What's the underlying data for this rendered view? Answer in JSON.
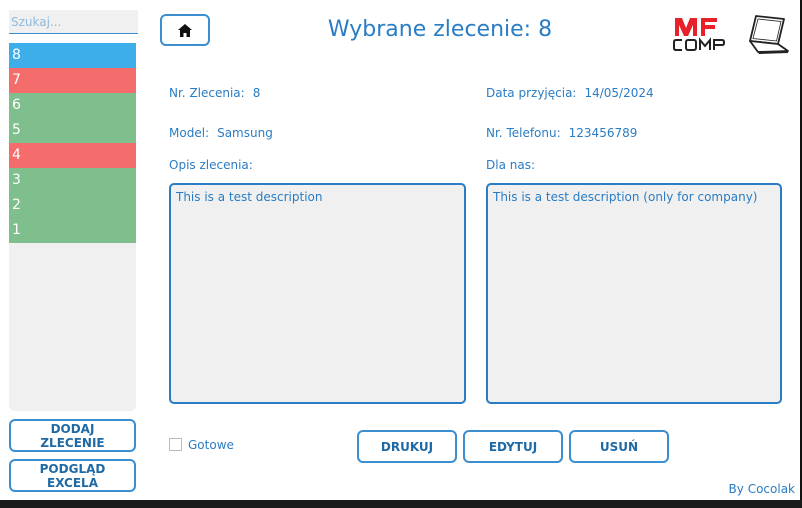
{
  "sidebar": {
    "search_placeholder": "Szukaj...",
    "orders": [
      {
        "label": "8",
        "color": "#3daee9"
      },
      {
        "label": "7",
        "color": "#f56c6c"
      },
      {
        "label": "6",
        "color": "#7fbf8e"
      },
      {
        "label": "5",
        "color": "#7fbf8e"
      },
      {
        "label": "4",
        "color": "#f56c6c"
      },
      {
        "label": "3",
        "color": "#7fbf8e"
      },
      {
        "label": "2",
        "color": "#7fbf8e"
      },
      {
        "label": "1",
        "color": "#7fbf8e"
      }
    ],
    "add_order_label": "DODAJ ZLECENIE",
    "excel_preview_label": "PODGLĄD EXCELA"
  },
  "header": {
    "home_icon": "home-icon",
    "title": "Wybrane zlecenie: 8",
    "logo": {
      "line1": "MF",
      "line2": "COMP",
      "colors": {
        "red": "#e8202a",
        "dark": "#222222"
      }
    }
  },
  "details": {
    "order_no_label": "Nr. Zlecenia:",
    "order_no_value": "8",
    "date_label": "Data przyjęcia:",
    "date_value": "14/05/2024",
    "model_label": "Model:",
    "model_value": "Samsung",
    "phone_label": "Nr. Telefonu:",
    "phone_value": "123456789",
    "description_label": "Opis zlecenia:",
    "description_value": "This is a test description",
    "internal_label": "Dla nas:",
    "internal_value": "This is a test description (only for company)"
  },
  "actions": {
    "done_label": "Gotowe",
    "done_checked": false,
    "print_label": "DRUKUJ",
    "edit_label": "EDYTUJ",
    "delete_label": "USUŃ"
  },
  "footer": {
    "credit": "By Cocolak"
  },
  "colors": {
    "accent": "#2a7cc4",
    "border": "#3b8ed0",
    "panel": "#f0f0f0"
  }
}
